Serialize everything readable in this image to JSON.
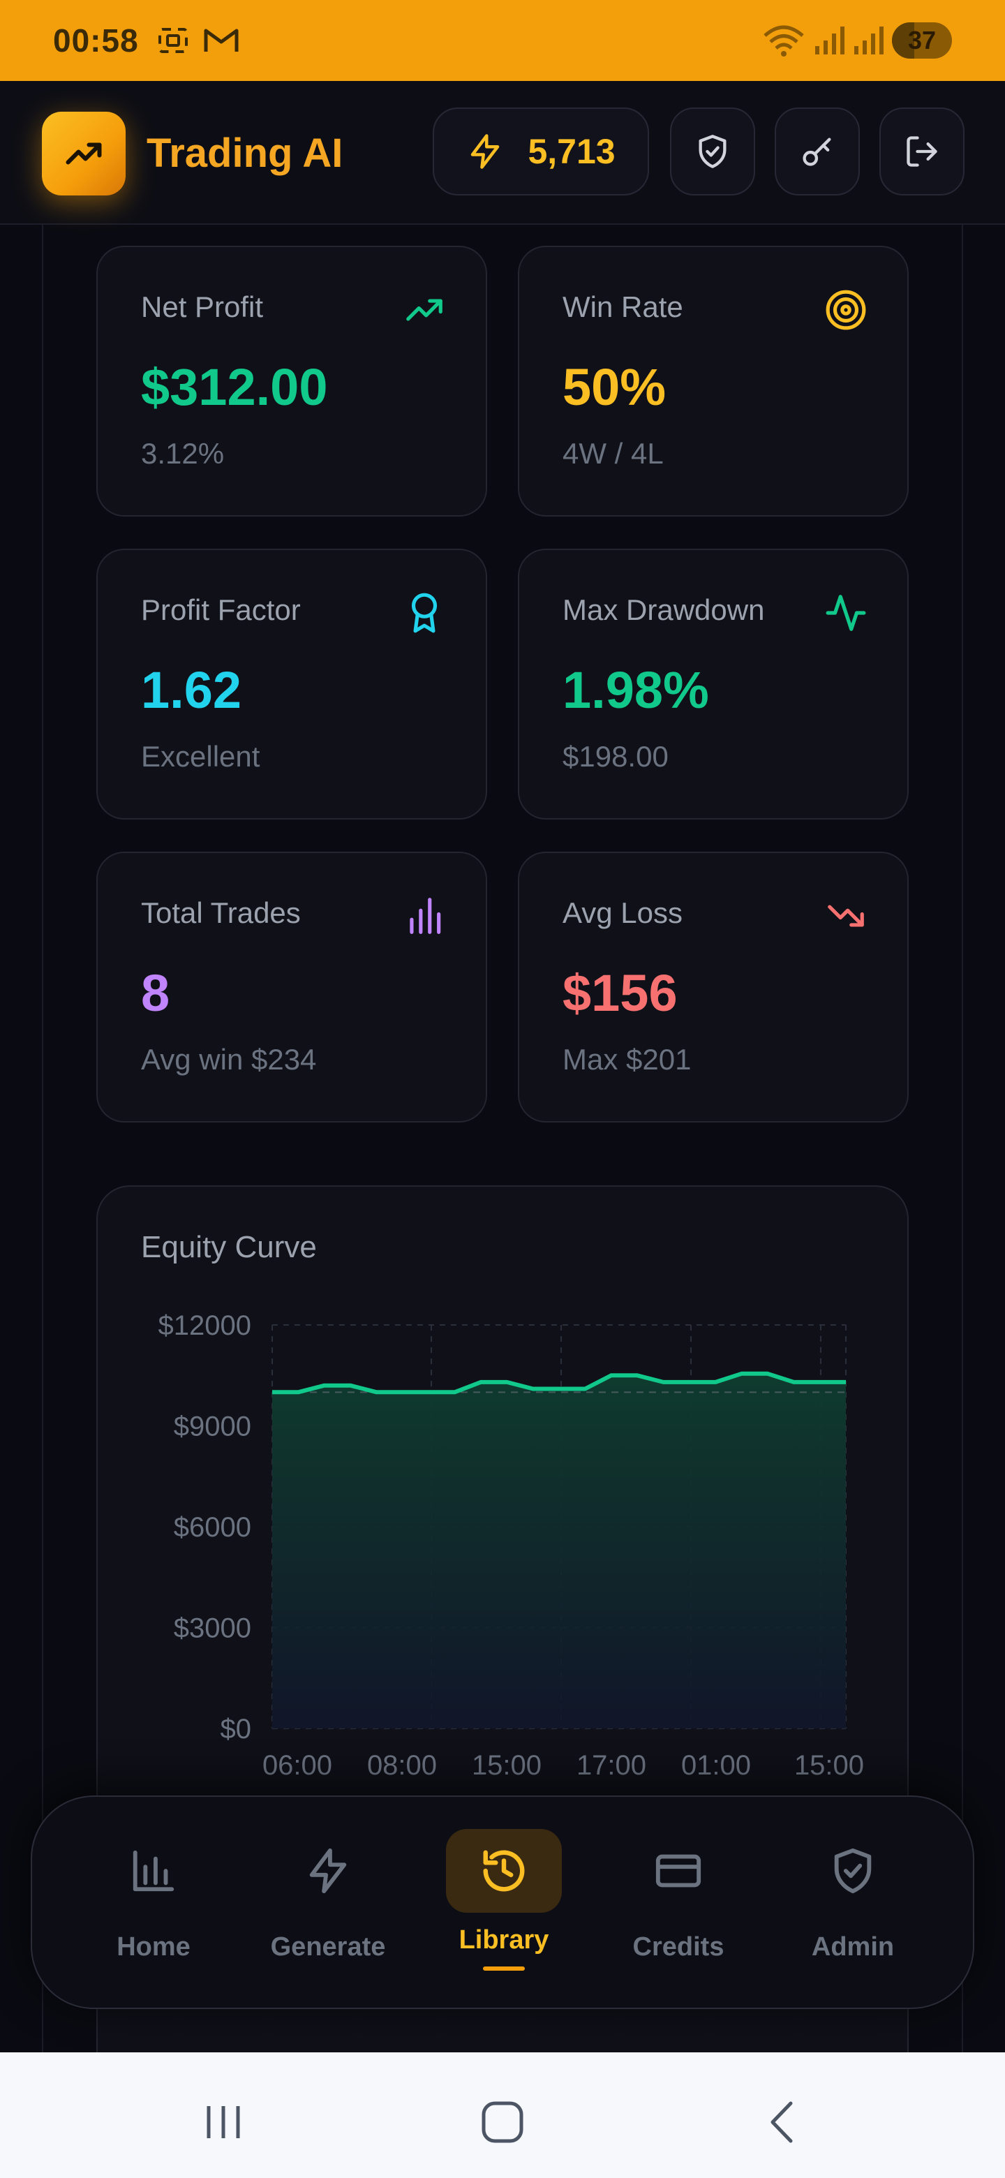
{
  "status_bar": {
    "time": "00:58",
    "battery": "37"
  },
  "header": {
    "app_title": "Trading AI",
    "credits": "5,713",
    "accent": "#f59e0b",
    "buttons": [
      "shield-check-icon",
      "key-icon",
      "logout-icon"
    ]
  },
  "stats": [
    {
      "label": "Net Profit",
      "value": "$312.00",
      "sub": "3.12%",
      "icon": "trending-up-icon",
      "color": "#10c98a"
    },
    {
      "label": "Win Rate",
      "value": "50%",
      "sub": "4W / 4L",
      "icon": "target-icon",
      "color": "#fbbf24"
    },
    {
      "label": "Profit Factor",
      "value": "1.62",
      "sub": "Excellent",
      "icon": "award-icon",
      "color": "#22d3ee"
    },
    {
      "label": "Max Drawdown",
      "value": "1.98%",
      "sub": "$198.00",
      "icon": "activity-icon",
      "color": "#10c98a"
    },
    {
      "label": "Total Trades",
      "value": "8",
      "sub": "Avg win $234",
      "icon": "bar-chart-icon",
      "color": "#c084fc"
    },
    {
      "label": "Avg Loss",
      "value": "$156",
      "sub": "Max $201",
      "icon": "trending-down-icon",
      "color": "#f87171"
    }
  ],
  "equity": {
    "title": "Equity Curve"
  },
  "chart_data": {
    "type": "area",
    "title": "Equity Curve",
    "xlabel": "",
    "ylabel": "",
    "x_tick_labels": [
      "06:00",
      "08:00",
      "15:00",
      "17:00",
      "01:00",
      "15:00"
    ],
    "y_tick_labels": [
      "$12000",
      "$9000",
      "$6000",
      "$3000",
      "$0"
    ],
    "ylim": [
      0,
      12000
    ],
    "baseline": 10000,
    "series": [
      {
        "values": [
          10000,
          10000,
          10200,
          10200,
          10000,
          10000,
          10000,
          10000,
          10300,
          10300,
          10100,
          10100,
          10100,
          10500,
          10500,
          10300,
          10300,
          10300,
          10550,
          10550,
          10300,
          10300,
          10300
        ]
      }
    ],
    "line_color": "#10c98a",
    "grid": true
  },
  "nav": {
    "items": [
      {
        "label": "Home",
        "icon": "bar-chart-icon"
      },
      {
        "label": "Generate",
        "icon": "lightning-icon"
      },
      {
        "label": "Library",
        "icon": "history-icon",
        "active": true
      },
      {
        "label": "Credits",
        "icon": "credit-card-icon"
      },
      {
        "label": "Admin",
        "icon": "shield-check-icon"
      }
    ]
  },
  "system_nav": [
    "recent-apps-icon",
    "home-icon",
    "back-icon"
  ]
}
